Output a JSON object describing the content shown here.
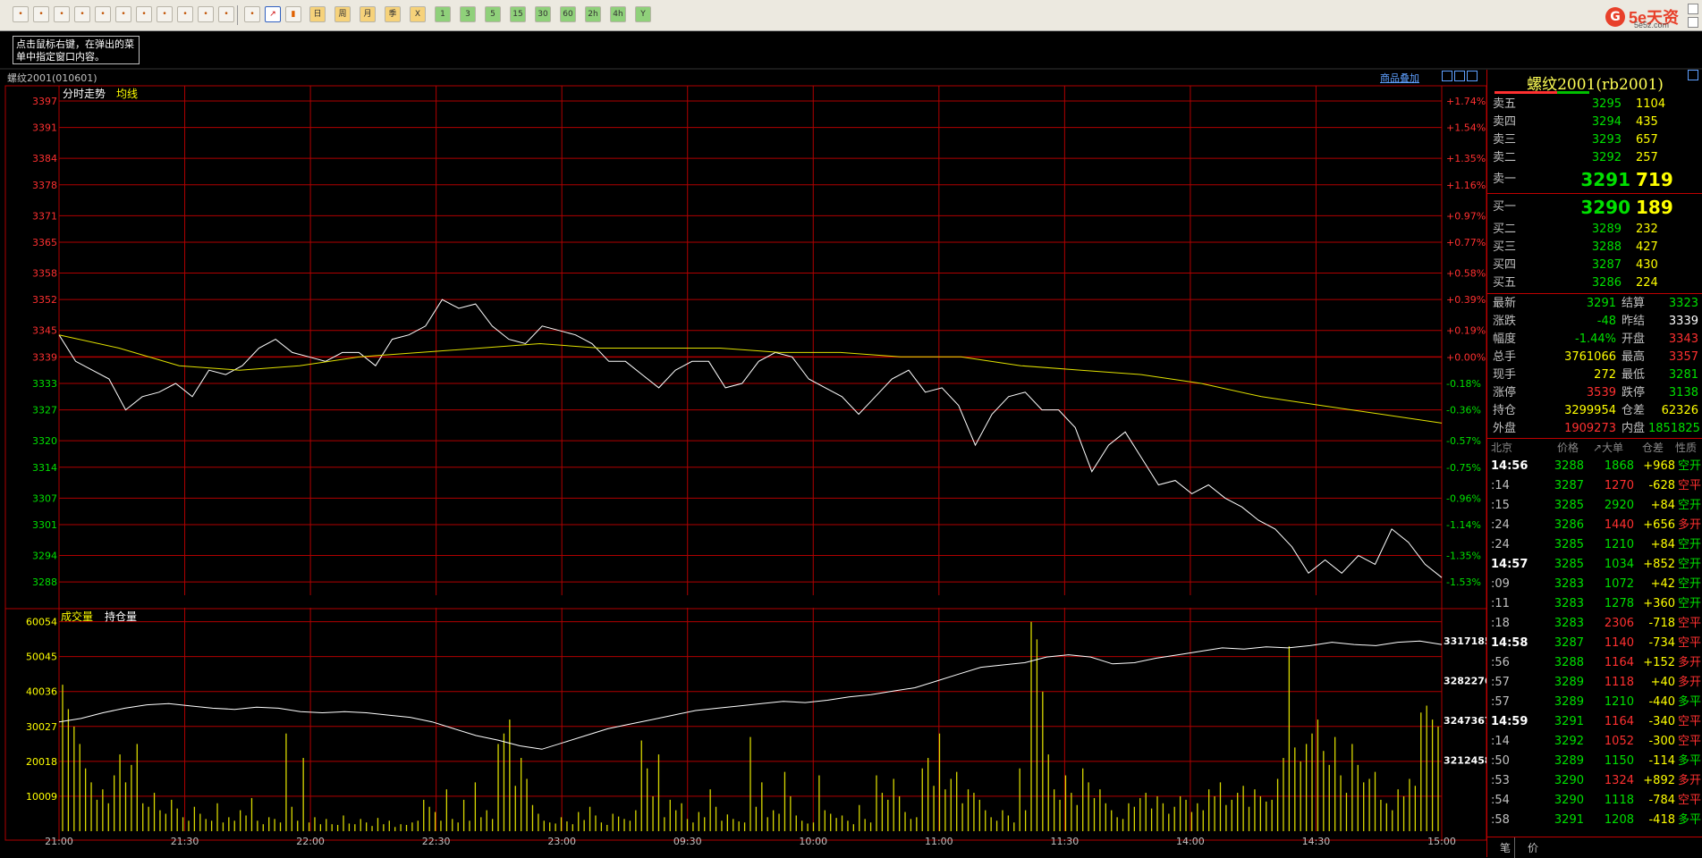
{
  "toolbar": {
    "buttons": [
      "home-icon",
      "folder-icon",
      "f10-icon",
      "refresh-icon",
      "zoom-in-icon",
      "zoom-out-icon",
      "window-icon",
      "draw-icon",
      "ruler-icon",
      "filter-icon",
      "indicator-icon",
      "table-icon",
      "line-chart-icon",
      "kline-icon"
    ],
    "periods": [
      "日",
      "周",
      "月",
      "季",
      "X",
      "1",
      "3",
      "5",
      "15",
      "30",
      "60",
      "2h",
      "4h",
      "Y"
    ],
    "logo": {
      "mark": "G",
      "title": "5e天资",
      "subtitle": "5e5z.com"
    }
  },
  "hint": "点击鼠标右键，在弹出的菜单中指定窗口内容。",
  "header": {
    "title": "螺纹2001(010601)",
    "overlay_link": "商品叠加"
  },
  "chart_data": [
    {
      "type": "line",
      "labels": {
        "trend": "分时走势",
        "avg": "均线"
      },
      "y_left_ticks": [
        3397,
        3391,
        3384,
        3378,
        3371,
        3365,
        3358,
        3352,
        3345,
        3339,
        3333,
        3327,
        3320,
        3314,
        3307,
        3301,
        3294,
        3288
      ],
      "y_right_ticks": [
        "+1.74%",
        "+1.54%",
        "+1.35%",
        "+1.16%",
        "+0.97%",
        "+0.77%",
        "+0.58%",
        "+0.39%",
        "+0.19%",
        "+0.00%",
        "-0.18%",
        "-0.36%",
        "-0.57%",
        "-0.75%",
        "-0.96%",
        "-1.14%",
        "-1.35%",
        "-1.53%"
      ],
      "ylim": [
        3285,
        3398
      ],
      "reference": 3339,
      "price_series": [
        3344,
        3338,
        3336,
        3334,
        3327,
        3330,
        3331,
        3333,
        3330,
        3336,
        3335,
        3337,
        3341,
        3343,
        3340,
        3339,
        3338,
        3340,
        3340,
        3337,
        3343,
        3344,
        3346,
        3352,
        3350,
        3351,
        3346,
        3343,
        3342,
        3346,
        3345,
        3344,
        3342,
        3338,
        3338,
        3335,
        3332,
        3336,
        3338,
        3338,
        3332,
        3333,
        3338,
        3340,
        3339,
        3334,
        3332,
        3330,
        3326,
        3330,
        3334,
        3336,
        3331,
        3332,
        3328,
        3319,
        3326,
        3330,
        3331,
        3327,
        3327,
        3323,
        3313,
        3319,
        3322,
        3316,
        3310,
        3311,
        3308,
        3310,
        3307,
        3305,
        3302,
        3300,
        3296,
        3290,
        3293,
        3290,
        3294,
        3292,
        3300,
        3297,
        3292,
        3289
      ],
      "avg_series": [
        3344,
        3341,
        3337,
        3336,
        3337,
        3339,
        3340,
        3341,
        3342,
        3341,
        3341,
        3341,
        3340,
        3340,
        3339,
        3339,
        3337,
        3336,
        3335,
        3333,
        3330,
        3328,
        3326,
        3324
      ],
      "x_ticks": [
        "21:00",
        "21:30",
        "22:00",
        "22:30",
        "23:00",
        "09:30",
        "10:00",
        "11:00",
        "11:30",
        "14:00",
        "14:30",
        "15:00"
      ]
    },
    {
      "type": "bar",
      "labels": {
        "vol": "成交量",
        "oi": "持仓量"
      },
      "y_left_ticks": [
        60054,
        50045,
        40036,
        30027,
        20018,
        10009
      ],
      "y_right_ticks": [
        3317185,
        3282276,
        3247367,
        3212458
      ],
      "ylim": [
        0,
        62000
      ],
      "volume_series": [
        42000,
        35000,
        30000,
        25000,
        18000,
        14000,
        9000,
        12000,
        8000,
        16000,
        22000,
        14000,
        19000,
        25000,
        8000,
        7000,
        11000,
        6000,
        5000,
        9000,
        6500,
        4000,
        3000,
        7000,
        5000,
        3500,
        3000,
        8000,
        2500,
        4000,
        3000,
        6000,
        4500,
        9500,
        3000,
        2000,
        4000,
        3500,
        2500,
        28000,
        7000,
        3000,
        21000,
        2500,
        4000,
        2000,
        3500,
        2000,
        1800,
        4500,
        2200,
        2000,
        3500,
        2500,
        1500,
        3800,
        2000,
        3000,
        1200,
        2000,
        1800,
        2500,
        3000,
        9000,
        7000,
        5500,
        3000,
        12000,
        3500,
        2500,
        9000,
        3000,
        14000,
        4000,
        6000,
        3500,
        25000,
        28000,
        32000,
        13000,
        21000,
        15000,
        7500,
        5000,
        3000,
        2500,
        2200,
        4000,
        2800,
        2000,
        5500,
        3200,
        7000,
        4500,
        2500,
        1800,
        5000,
        4200,
        3500,
        3000,
        6000,
        26000,
        18000,
        10000,
        22000,
        4000,
        9000,
        6000,
        8000,
        3500,
        2500,
        5500,
        4000,
        12000,
        7000,
        3000,
        4800,
        3500,
        2800,
        2500,
        27000,
        7000,
        14000,
        4000,
        6000,
        5000,
        17000,
        10000,
        4500,
        3000,
        2200,
        2500,
        16000,
        6000,
        5000,
        3800,
        4500,
        3000,
        2000,
        7500,
        3500,
        2500,
        16000,
        11000,
        9000,
        15000,
        10000,
        5500,
        3500,
        4000,
        18000,
        21000,
        13000,
        28000,
        12000,
        15000,
        17000,
        8000,
        12000,
        11000,
        9000,
        6000,
        4000,
        3000,
        6000,
        4500,
        2500,
        18000,
        6000,
        60000,
        55000,
        40000,
        22000,
        12000,
        9000,
        16000,
        11000,
        7500,
        18000,
        14000,
        9500,
        12000,
        8000,
        6000,
        4000,
        3500,
        8000,
        7000,
        9500,
        11000,
        6500,
        10000,
        8000,
        5000,
        7000,
        10000,
        9000,
        5500,
        8000,
        6000,
        12000,
        10000,
        14000,
        7500,
        9000,
        11000,
        13000,
        7000,
        12000,
        10000,
        8500,
        9000,
        15000,
        21000,
        53000,
        24000,
        20000,
        25000,
        28000,
        32000,
        23000,
        19000,
        27000,
        16000,
        11000,
        25000,
        19000,
        14000,
        15000,
        17000,
        9000,
        8000,
        6000,
        12000,
        10000,
        15000,
        13000,
        34000,
        36000,
        32000,
        30000
      ],
      "oi_series": [
        3246000,
        3249000,
        3254000,
        3258000,
        3261000,
        3262000,
        3260000,
        3258000,
        3257000,
        3259000,
        3258000,
        3255000,
        3254000,
        3255000,
        3254000,
        3252000,
        3250000,
        3246000,
        3240000,
        3234000,
        3230000,
        3225000,
        3222000,
        3228000,
        3234000,
        3240000,
        3244000,
        3248000,
        3252000,
        3256000,
        3258000,
        3260000,
        3262000,
        3264000,
        3263000,
        3265000,
        3268000,
        3270000,
        3273000,
        3276000,
        3282000,
        3288000,
        3294000,
        3296000,
        3298000,
        3303000,
        3305000,
        3303000,
        3297000,
        3298000,
        3302000,
        3305000,
        3308000,
        3311000,
        3310000,
        3312000,
        3311000,
        3313000,
        3316000,
        3314000,
        3313000,
        3316000,
        3317000,
        3314000
      ]
    }
  ],
  "right_panel": {
    "title": "螺纹2001(rb2001)",
    "asks": [
      {
        "label": "卖五",
        "price": "3295",
        "vol": "1104"
      },
      {
        "label": "卖四",
        "price": "3294",
        "vol": "435"
      },
      {
        "label": "卖三",
        "price": "3293",
        "vol": "657"
      },
      {
        "label": "卖二",
        "price": "3292",
        "vol": "257"
      }
    ],
    "ask1": {
      "label": "卖一",
      "price": "3291",
      "vol": "719"
    },
    "bid1": {
      "label": "买一",
      "price": "3290",
      "vol": "189"
    },
    "bids": [
      {
        "label": "买二",
        "price": "3289",
        "vol": "232"
      },
      {
        "label": "买三",
        "price": "3288",
        "vol": "427"
      },
      {
        "label": "买四",
        "price": "3287",
        "vol": "430"
      },
      {
        "label": "买五",
        "price": "3286",
        "vol": "224"
      }
    ],
    "stats": [
      {
        "l1": "最新",
        "v1": "3291",
        "c1": "#00e000",
        "l2": "结算",
        "v2": "3323",
        "c2": "#00e000"
      },
      {
        "l1": "涨跌",
        "v1": "-48",
        "c1": "#00e000",
        "l2": "昨结",
        "v2": "3339",
        "c2": "#ffffff"
      },
      {
        "l1": "幅度",
        "v1": "-1.44%",
        "c1": "#00e000",
        "l2": "开盘",
        "v2": "3343",
        "c2": "#ff3030"
      },
      {
        "l1": "总手",
        "v1": "3761066",
        "c1": "#ffff00",
        "l2": "最高",
        "v2": "3357",
        "c2": "#ff3030"
      },
      {
        "l1": "现手",
        "v1": "272",
        "c1": "#ffff00",
        "l2": "最低",
        "v2": "3281",
        "c2": "#00e000"
      },
      {
        "l1": "涨停",
        "v1": "3539",
        "c1": "#ff3030",
        "l2": "跌停",
        "v2": "3138",
        "c2": "#00e000"
      },
      {
        "l1": "持仓",
        "v1": "3299954",
        "c1": "#ffff00",
        "l2": "仓差",
        "v2": "62326",
        "c2": "#ffff00"
      },
      {
        "l1": "外盘",
        "v1": "1909273",
        "c1": "#ff3030",
        "l2": "内盘",
        "v2": "1851825",
        "c2": "#00e000"
      }
    ],
    "trade_header": {
      "time": "北京",
      "price": "价格",
      "vol": "↗大单",
      "diff": "仓差",
      "type": "性质"
    },
    "trades": [
      {
        "t": "14:56",
        "big": true,
        "p": "3288",
        "v": "1868",
        "vc": "#00e000",
        "d": "+968",
        "ty": "空开",
        "tc": "#00e000"
      },
      {
        "t": ":14",
        "big": false,
        "p": "3287",
        "v": "1270",
        "vc": "#ff3030",
        "d": "-628",
        "ty": "空平",
        "tc": "#ff3030"
      },
      {
        "t": ":15",
        "big": false,
        "p": "3285",
        "v": "2920",
        "vc": "#00e000",
        "d": "+84",
        "ty": "空开",
        "tc": "#00e000"
      },
      {
        "t": ":24",
        "big": false,
        "p": "3286",
        "v": "1440",
        "vc": "#ff3030",
        "d": "+656",
        "ty": "多开",
        "tc": "#ff3030"
      },
      {
        "t": ":24",
        "big": false,
        "p": "3285",
        "v": "1210",
        "vc": "#00e000",
        "d": "+84",
        "ty": "空开",
        "tc": "#00e000"
      },
      {
        "t": "14:57",
        "big": true,
        "p": "3285",
        "v": "1034",
        "vc": "#00e000",
        "d": "+852",
        "ty": "空开",
        "tc": "#00e000"
      },
      {
        "t": ":09",
        "big": false,
        "p": "3283",
        "v": "1072",
        "vc": "#00e000",
        "d": "+42",
        "ty": "空开",
        "tc": "#00e000"
      },
      {
        "t": ":11",
        "big": false,
        "p": "3283",
        "v": "1278",
        "vc": "#00e000",
        "d": "+360",
        "ty": "空开",
        "tc": "#00e000"
      },
      {
        "t": ":18",
        "big": false,
        "p": "3283",
        "v": "2306",
        "vc": "#ff3030",
        "d": "-718",
        "ty": "空平",
        "tc": "#ff3030"
      },
      {
        "t": "14:58",
        "big": true,
        "p": "3287",
        "v": "1140",
        "vc": "#ff3030",
        "d": "-734",
        "ty": "空平",
        "tc": "#ff3030"
      },
      {
        "t": ":56",
        "big": false,
        "p": "3288",
        "v": "1164",
        "vc": "#ff3030",
        "d": "+152",
        "ty": "多开",
        "tc": "#ff3030"
      },
      {
        "t": ":57",
        "big": false,
        "p": "3289",
        "v": "1118",
        "vc": "#ff3030",
        "d": "+40",
        "ty": "多开",
        "tc": "#ff3030"
      },
      {
        "t": ":57",
        "big": false,
        "p": "3289",
        "v": "1210",
        "vc": "#00e000",
        "d": "-440",
        "ty": "多平",
        "tc": "#00e000"
      },
      {
        "t": "14:59",
        "big": true,
        "p": "3291",
        "v": "1164",
        "vc": "#ff3030",
        "d": "-340",
        "ty": "空平",
        "tc": "#ff3030"
      },
      {
        "t": ":14",
        "big": false,
        "p": "3292",
        "v": "1052",
        "vc": "#ff3030",
        "d": "-300",
        "ty": "空平",
        "tc": "#ff3030"
      },
      {
        "t": ":50",
        "big": false,
        "p": "3289",
        "v": "1150",
        "vc": "#00e000",
        "d": "-114",
        "ty": "多平",
        "tc": "#00e000"
      },
      {
        "t": ":53",
        "big": false,
        "p": "3290",
        "v": "1324",
        "vc": "#ff3030",
        "d": "+892",
        "ty": "多开",
        "tc": "#ff3030"
      },
      {
        "t": ":54",
        "big": false,
        "p": "3290",
        "v": "1118",
        "vc": "#00e000",
        "d": "-784",
        "ty": "空平",
        "tc": "#ff3030"
      },
      {
        "t": ":58",
        "big": false,
        "p": "3291",
        "v": "1208",
        "vc": "#00e000",
        "d": "-418",
        "ty": "多平",
        "tc": "#00e000"
      }
    ],
    "tabs": [
      "笔",
      "价"
    ]
  }
}
